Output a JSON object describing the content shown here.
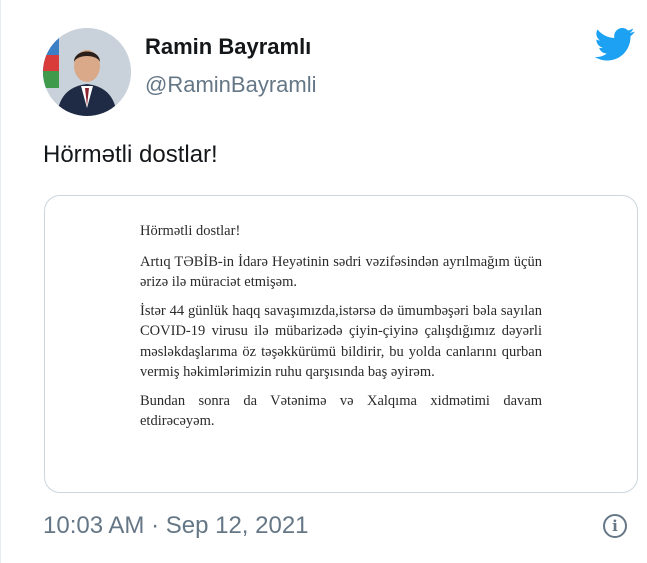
{
  "author": {
    "display_name": "Ramin Bayramlı",
    "handle": "@RaminBayramli",
    "avatar_icon": "profile-photo"
  },
  "tweet": {
    "text": "Hörmətli dostlar!",
    "timestamp": "10:03 AM · Sep 12, 2021"
  },
  "attachment": {
    "greeting": "Hörmətli dostlar!",
    "paragraphs": [
      "Artıq TƏBİB-in İdarə Heyətinin sədri vəzifəsindən ayrılmağım üçün ərizə ilə müraciət etmişəm.",
      "İstər 44 günlük haqq savaşımızda,istərsə də ümumbəşəri bəla sayılan COVID-19 virusu ilə mübarizədə çiyin-çiyinə çalışdığımız dəyərli məslәkdaşlarıma öz təşəkkürümü bildirir, bu yolda canlarını qurban vermiş həkimlərimizin ruhu qarşısında baş əyirəm.",
      "Bundan sonra da Vətənimə və Xalqıma xidmətimi davam etdirəcəyəm."
    ]
  },
  "icons": {
    "brand": "twitter-bird-icon",
    "info": "info-icon",
    "info_glyph": "i"
  },
  "colors": {
    "twitter_blue": "#1da1f2",
    "primary_text": "#14171a",
    "secondary_text": "#657786",
    "border": "#ccd6dd"
  }
}
